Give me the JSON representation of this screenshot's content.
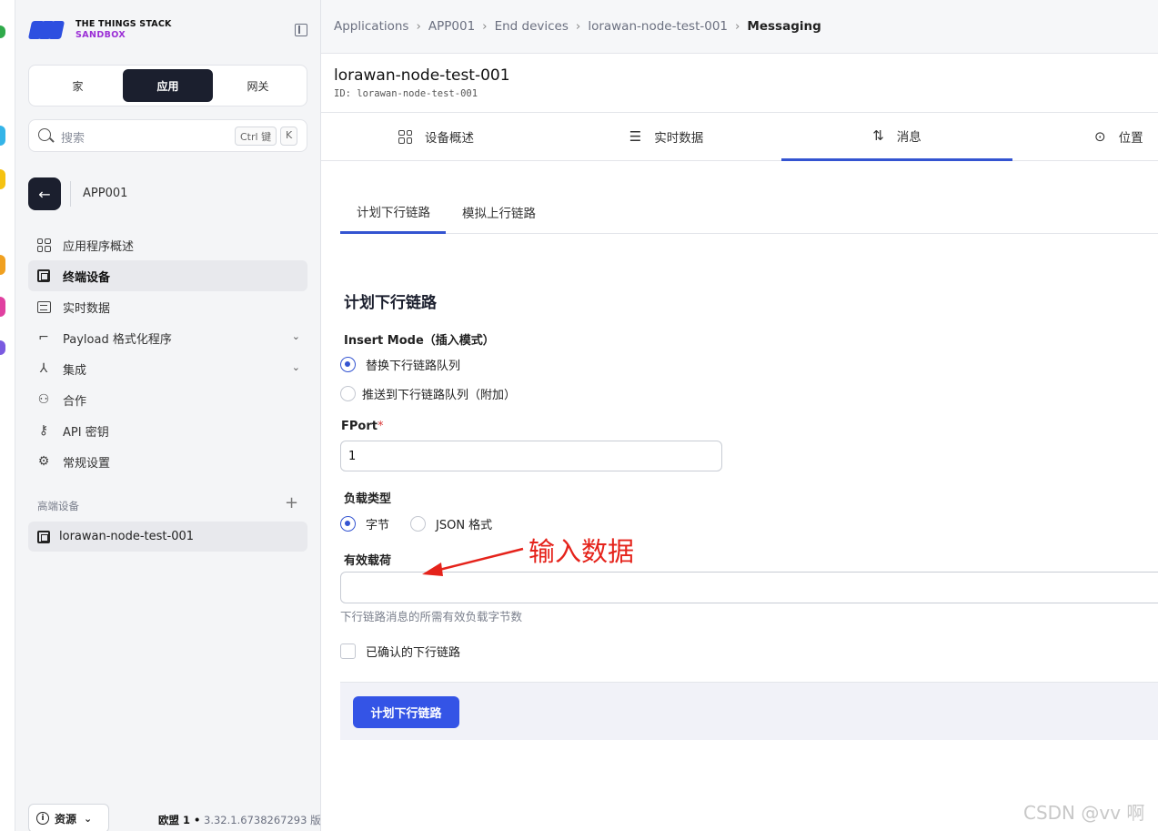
{
  "sidebar": {
    "logo_line1": "THE THINGS STACK",
    "logo_line2": "SANDBOX",
    "switcher": [
      "家",
      "应用",
      "网关"
    ],
    "switcher_active": 1,
    "search_placeholder": "搜索",
    "search_kbd1": "Ctrl 键",
    "search_kbd2": "K",
    "app_name": "APP001",
    "nav": [
      {
        "label": "应用程序概述",
        "icon": "grid-icon"
      },
      {
        "label": "终端设备",
        "icon": "chip-icon",
        "active": true
      },
      {
        "label": "实时数据",
        "icon": "list-icon"
      },
      {
        "label": "Payload 格式化程序",
        "icon": "code-icon",
        "expand": true
      },
      {
        "label": "集成",
        "icon": "fork-icon",
        "expand": true
      },
      {
        "label": "合作",
        "icon": "users-icon"
      },
      {
        "label": "API 密钥",
        "icon": "key-icon"
      },
      {
        "label": "常规设置",
        "icon": "gear-icon"
      }
    ],
    "section_heading": "高端设备",
    "device": "lorawan-node-test-001",
    "resources_label": "资源",
    "region": "欧盟 1 •",
    "version": "3.32.1.6738267293 版"
  },
  "breadcrumb": [
    "Applications",
    "APP001",
    "End devices",
    "lorawan-node-test-001",
    "Messaging"
  ],
  "device": {
    "title": "lorawan-node-test-001",
    "id_line": "ID: lorawan-node-test-001"
  },
  "tabs": [
    "设备概述",
    "实时数据",
    "消息",
    "位置"
  ],
  "active_tab": 2,
  "subtabs": [
    "计划下行链路",
    "模拟上行链路"
  ],
  "form": {
    "title": "计划下行链路",
    "insert_mode_label": "Insert Mode（插入模式）",
    "insert_options": [
      "替换下行链路队列",
      "推送到下行链路队列（附加）"
    ],
    "insert_selected": 0,
    "fport_label": "FPort",
    "fport_required": "*",
    "fport_value": "1",
    "payload_type_label": "负载类型",
    "payload_types": [
      "字节",
      "JSON 格式"
    ],
    "payload_type_selected": 0,
    "payload_label": "有效载荷",
    "payload_value": "",
    "payload_hint": "下行链路消息的所需有效负载字节数",
    "confirmed_label": "已确认的下行链路",
    "confirmed": false,
    "submit_label": "计划下行链路"
  },
  "annotation": "输入数据",
  "watermark": "CSDN @vv 啊",
  "colors": {
    "accent": "#3454d1",
    "button": "#3454e6",
    "dark": "#1b1f2e",
    "annotation": "#e5231b"
  }
}
